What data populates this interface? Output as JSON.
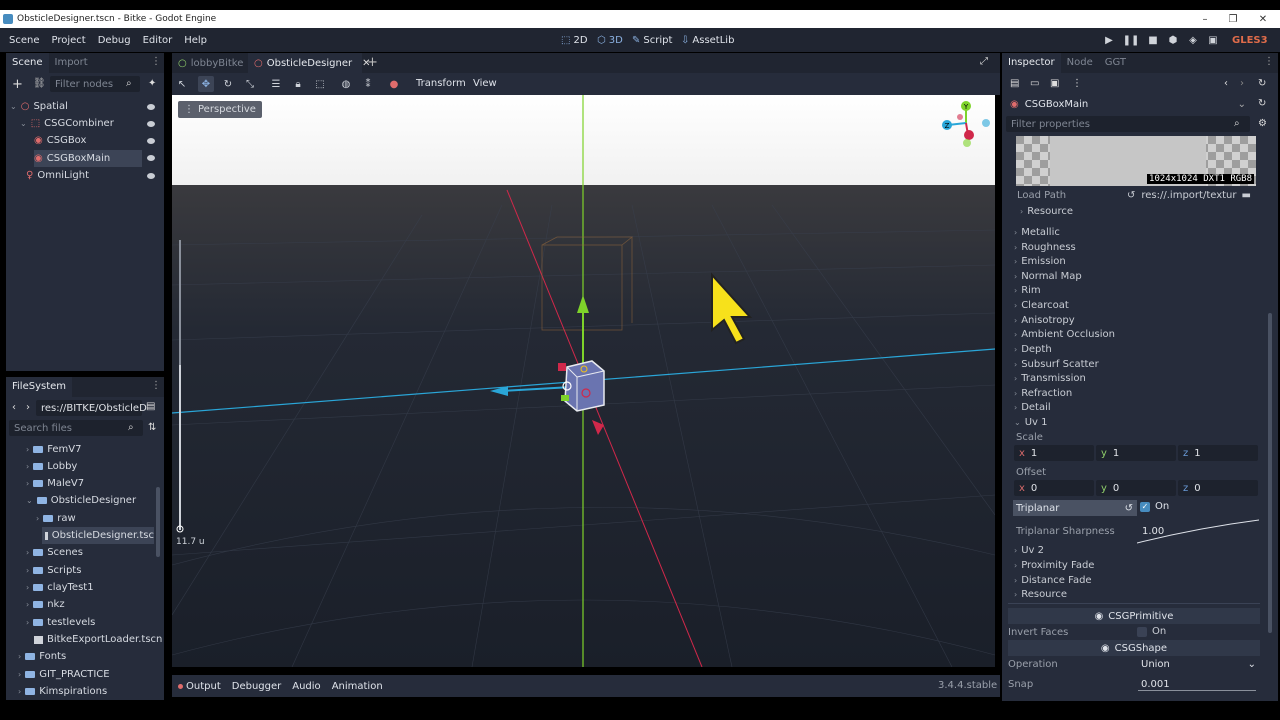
{
  "window": {
    "title": "ObsticleDesigner.tscn - Bitke - Godot Engine",
    "minimize": "–",
    "restore": "❐",
    "close": "✕"
  },
  "menu": {
    "items": [
      "Scene",
      "Project",
      "Debug",
      "Editor",
      "Help"
    ]
  },
  "modes": {
    "m2d": "2D",
    "m3d": "3D",
    "script": "Script",
    "assetlib": "AssetLib"
  },
  "renderer": "GLES3",
  "scene_dock": {
    "tabs": [
      "Scene",
      "Import"
    ],
    "filter_placeholder": "Filter nodes",
    "nodes": [
      "Spatial",
      "CSGCombiner",
      "CSGBox",
      "CSGBoxMain",
      "OmniLight"
    ]
  },
  "filesystem": {
    "title": "FileSystem",
    "path": "res://BITKE/ObsticleD",
    "search_placeholder": "Search files",
    "items": [
      "FemV7",
      "Lobby",
      "MaleV7",
      "ObsticleDesigner",
      "raw",
      "ObsticleDesigner.tsc",
      "Scenes",
      "Scripts",
      "clayTest1",
      "nkz",
      "testlevels",
      "BitkeExportLoader.tscn",
      "Fonts",
      "GIT_PRACTICE",
      "Kimspirations"
    ]
  },
  "editor_tabs": [
    "lobbyBitke",
    "ObsticleDesigner"
  ],
  "viewport": {
    "menus": [
      "Transform",
      "View"
    ],
    "perspective": "Perspective",
    "zoom_label": "11.7 u"
  },
  "bottom": {
    "tabs": [
      "Output",
      "Debugger",
      "Audio",
      "Animation"
    ],
    "version": "3.4.4.stable"
  },
  "inspector": {
    "tabs": [
      "Inspector",
      "Node",
      "GGT"
    ],
    "object": "CSGBoxMain",
    "filter_placeholder": "Filter properties",
    "texture_info": "1024x1024 DXT1 RGB8",
    "load_path_label": "Load Path",
    "load_path_value": "res://.import/textur",
    "resource": "Resource",
    "sections": [
      "Metallic",
      "Roughness",
      "Emission",
      "Normal Map",
      "Rim",
      "Clearcoat",
      "Anisotropy",
      "Ambient Occlusion",
      "Depth",
      "Subsurf Scatter",
      "Transmission",
      "Refraction",
      "Detail",
      "Uv 1"
    ],
    "scale_label": "Scale",
    "scale": {
      "x": "1",
      "y": "1",
      "z": "1"
    },
    "offset_label": "Offset",
    "offset": {
      "x": "0",
      "y": "0",
      "z": "0"
    },
    "axis": {
      "x": "x",
      "y": "y",
      "z": "z"
    },
    "triplanar_label": "Triplanar",
    "triplanar_value": "On",
    "triplanar_sharpness_label": "Triplanar Sharpness",
    "triplanar_sharpness_value": "1.00",
    "after": [
      "Uv 2",
      "Proximity Fade",
      "Distance Fade",
      "Resource"
    ],
    "csgprimitive": "CSGPrimitive",
    "invert_faces_label": "Invert Faces",
    "invert_faces_value": "On",
    "csgshape": "CSGShape",
    "operation_label": "Operation",
    "operation_value": "Union",
    "snap_label": "Snap",
    "snap_value": "0.001"
  },
  "colors": {
    "accent": "#478cbf",
    "panel": "#262c3b",
    "bg": "#202531",
    "selected": "#3c4456"
  }
}
